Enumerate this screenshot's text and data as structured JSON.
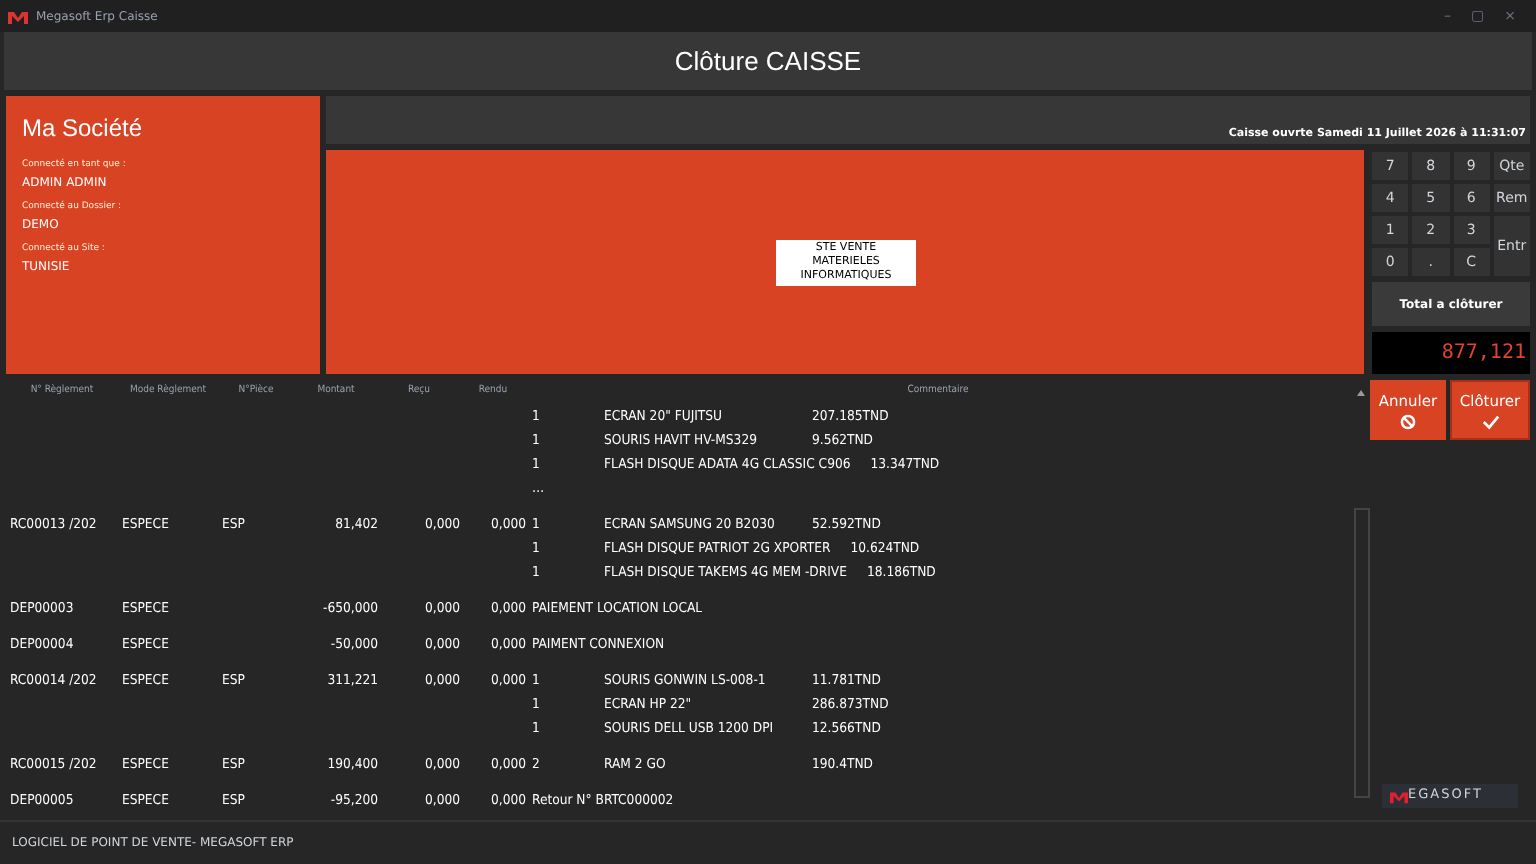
{
  "window": {
    "title": "Megasoft Erp Caisse",
    "controls": [
      "–",
      "▢",
      "×"
    ]
  },
  "header": {
    "title": "Clôture CAISSE"
  },
  "company": {
    "name": "Ma Société",
    "fields": [
      {
        "label": "Connecté en tant que :",
        "value": "ADMIN ADMIN"
      },
      {
        "label": "Connecté au Dossier :",
        "value": "DEMO"
      },
      {
        "label": "Connecté au Site :",
        "value": "TUNISIE"
      }
    ]
  },
  "session": {
    "status": "Caisse ouvrte Samedi 11 Juillet 2026 à 11:31:07"
  },
  "banner": {
    "label": "STE VENTE MATERIELES INFORMATIQUES"
  },
  "keypad": {
    "keys": [
      {
        "label": "7",
        "kind": "key"
      },
      {
        "label": "8",
        "kind": "key"
      },
      {
        "label": "9",
        "kind": "key"
      },
      {
        "label": "Qte",
        "kind": "key"
      },
      {
        "label": "4",
        "kind": "key"
      },
      {
        "label": "5",
        "kind": "key"
      },
      {
        "label": "6",
        "kind": "key"
      },
      {
        "label": "Rem",
        "kind": "key"
      },
      {
        "label": "1",
        "kind": "key"
      },
      {
        "label": "2",
        "kind": "key"
      },
      {
        "label": "3",
        "kind": "key"
      },
      {
        "label": "Entr",
        "kind": "tall"
      },
      {
        "label": "0",
        "kind": "key"
      },
      {
        "label": ".",
        "kind": "key"
      },
      {
        "label": "C",
        "kind": "key"
      }
    ]
  },
  "total": {
    "label": "Total a clôturer",
    "value": "877,121"
  },
  "actions": [
    {
      "label": "Annuler",
      "kind": "cancel"
    },
    {
      "label": "Clôturer",
      "kind": "confirm"
    }
  ],
  "table": {
    "columns": [
      "N° Règlement",
      "Mode Règlement",
      "N°Pièce",
      "Montant",
      "Reçu",
      "Rendu",
      "Commentaire"
    ],
    "rows": [
      {
        "cells": [],
        "kind": "items",
        "lines": [
          {
            "qty": "1",
            "item": "ECRAN 20\" FUJITSU",
            "price": "207.185TND"
          },
          {
            "qty": "1",
            "item": "SOURIS HAVIT HV-MS329",
            "price": "9.562TND"
          },
          {
            "qty": "1",
            "item": "FLASH DISQUE ADATA 4G CLASSIC C906",
            "price": "13.347TND"
          },
          {
            "qty": "…"
          }
        ]
      },
      {
        "cells": [
          "RC00013 /202",
          "ESPECE",
          "ESP",
          "81,402",
          "0,000",
          "0,000"
        ],
        "kind": "items",
        "lines": [
          {
            "qty": "1",
            "item": "ECRAN SAMSUNG 20 B2030",
            "price": "52.592TND"
          },
          {
            "qty": "1",
            "item": "FLASH DISQUE PATRIOT  2G XPORTER",
            "price": "10.624TND"
          },
          {
            "qty": "1",
            "item": "FLASH DISQUE TAKEMS 4G MEM -DRIVE",
            "price": "18.186TND"
          }
        ]
      },
      {
        "cells": [
          "DEP00003",
          "ESPECE",
          "",
          "-650,000",
          "0,000",
          "0,000"
        ],
        "kind": "text",
        "comment": "PAIEMENT LOCATION LOCAL"
      },
      {
        "cells": [
          "DEP00004",
          "ESPECE",
          "",
          "-50,000",
          "0,000",
          "0,000"
        ],
        "kind": "text",
        "comment": "PAIMENT CONNEXION"
      },
      {
        "cells": [
          "RC00014 /202",
          "ESPECE",
          "ESP",
          "311,221",
          "0,000",
          "0,000"
        ],
        "kind": "items",
        "lines": [
          {
            "qty": "1",
            "item": "SOURIS GONWIN LS-008-1",
            "price": "11.781TND"
          },
          {
            "qty": "1",
            "item": "ECRAN HP 22\"",
            "price": "286.873TND"
          },
          {
            "qty": "1",
            "item": "SOURIS DELL USB 1200 DPI",
            "price": "12.566TND"
          }
        ]
      },
      {
        "cells": [
          "RC00015 /202",
          "ESPECE",
          "ESP",
          "190,400",
          "0,000",
          "0,000"
        ],
        "kind": "items",
        "lines": [
          {
            "qty": "2",
            "item": "RAM 2 GO",
            "price": "190.4TND"
          }
        ]
      },
      {
        "cells": [
          "DEP00005",
          "ESPECE",
          "ESP",
          "-95,200",
          "0,000",
          "0,000"
        ],
        "kind": "text",
        "comment": "Retour N° BRTC000002"
      }
    ]
  },
  "logo": {
    "text": "EGASOFT"
  },
  "status_bar": {
    "text": "LOGICIEL DE POINT DE VENTE- MEGASOFT ERP"
  }
}
